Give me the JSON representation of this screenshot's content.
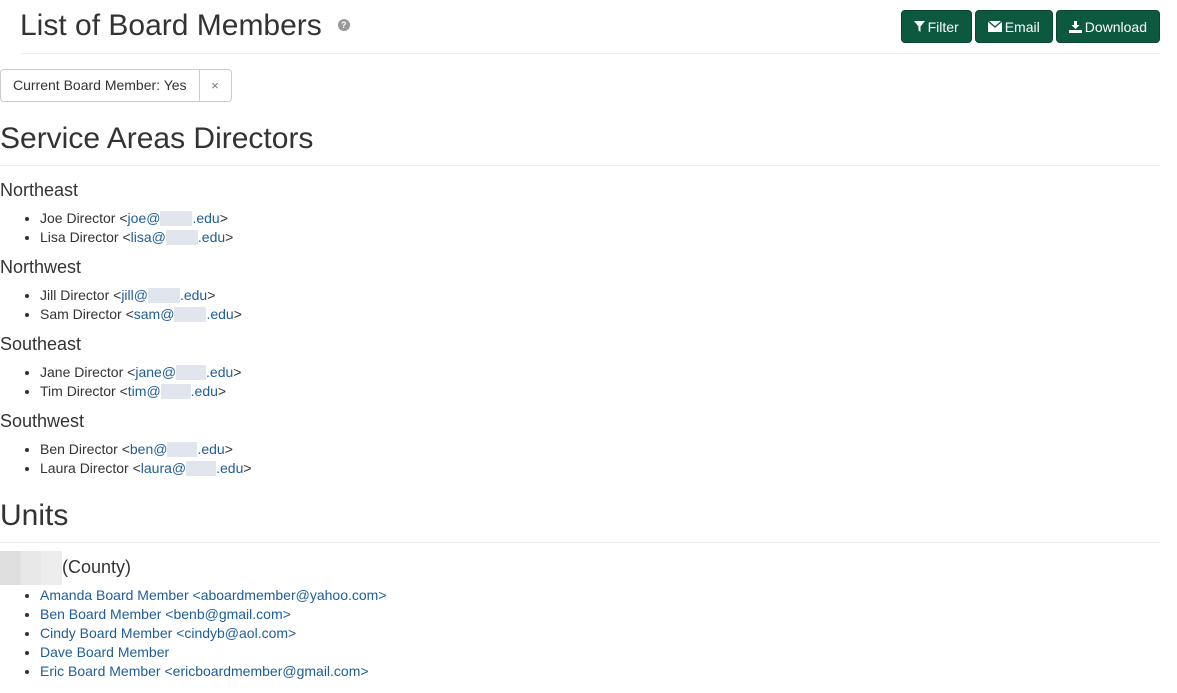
{
  "header": {
    "title": "List of Board Members",
    "help_icon": "question-circle-icon",
    "buttons": {
      "filter": {
        "label": "Filter",
        "icon": "filter-icon"
      },
      "email": {
        "label": "Email",
        "icon": "envelope-icon"
      },
      "download": {
        "label": "Download",
        "icon": "download-icon"
      }
    }
  },
  "active_filter": {
    "label": "Current Board Member: Yes",
    "remove": "×"
  },
  "colors": {
    "button_bg": "#0d5940",
    "link": "#1f5d9a",
    "text": "#333333"
  },
  "service_areas": {
    "title": "Service Areas Directors",
    "regions": [
      {
        "name": "Northeast",
        "members": [
          {
            "name": "Joe Director",
            "email_user": "joe@",
            "email_domain": ".edu"
          },
          {
            "name": "Lisa Director",
            "email_user": "lisa@",
            "email_domain": ".edu"
          }
        ]
      },
      {
        "name": "Northwest",
        "members": [
          {
            "name": "Jill Director",
            "email_user": "jill@",
            "email_domain": ".edu"
          },
          {
            "name": "Sam Director",
            "email_user": "sam@",
            "email_domain": ".edu"
          }
        ]
      },
      {
        "name": "Southeast",
        "members": [
          {
            "name": "Jane Director",
            "email_user": "jane@",
            "email_domain": ".edu"
          },
          {
            "name": "Tim Director",
            "email_user": "tim@",
            "email_domain": ".edu"
          }
        ]
      },
      {
        "name": "Southwest",
        "members": [
          {
            "name": "Ben Director",
            "email_user": "ben@",
            "email_domain": ".edu"
          },
          {
            "name": "Laura Director",
            "email_user": "laura@",
            "email_domain": ".edu"
          }
        ]
      }
    ]
  },
  "units": {
    "title": "Units",
    "unit_suffix": "(County)",
    "members": [
      {
        "text": "Amanda Board Member <aboardmember@yahoo.com>"
      },
      {
        "text": "Ben Board Member <benb@gmail.com>"
      },
      {
        "text": "Cindy Board Member <cindyb@aol.com>"
      },
      {
        "text": "Dave Board Member"
      },
      {
        "text": "Eric Board Member <ericboardmember@gmail.com>"
      }
    ]
  }
}
